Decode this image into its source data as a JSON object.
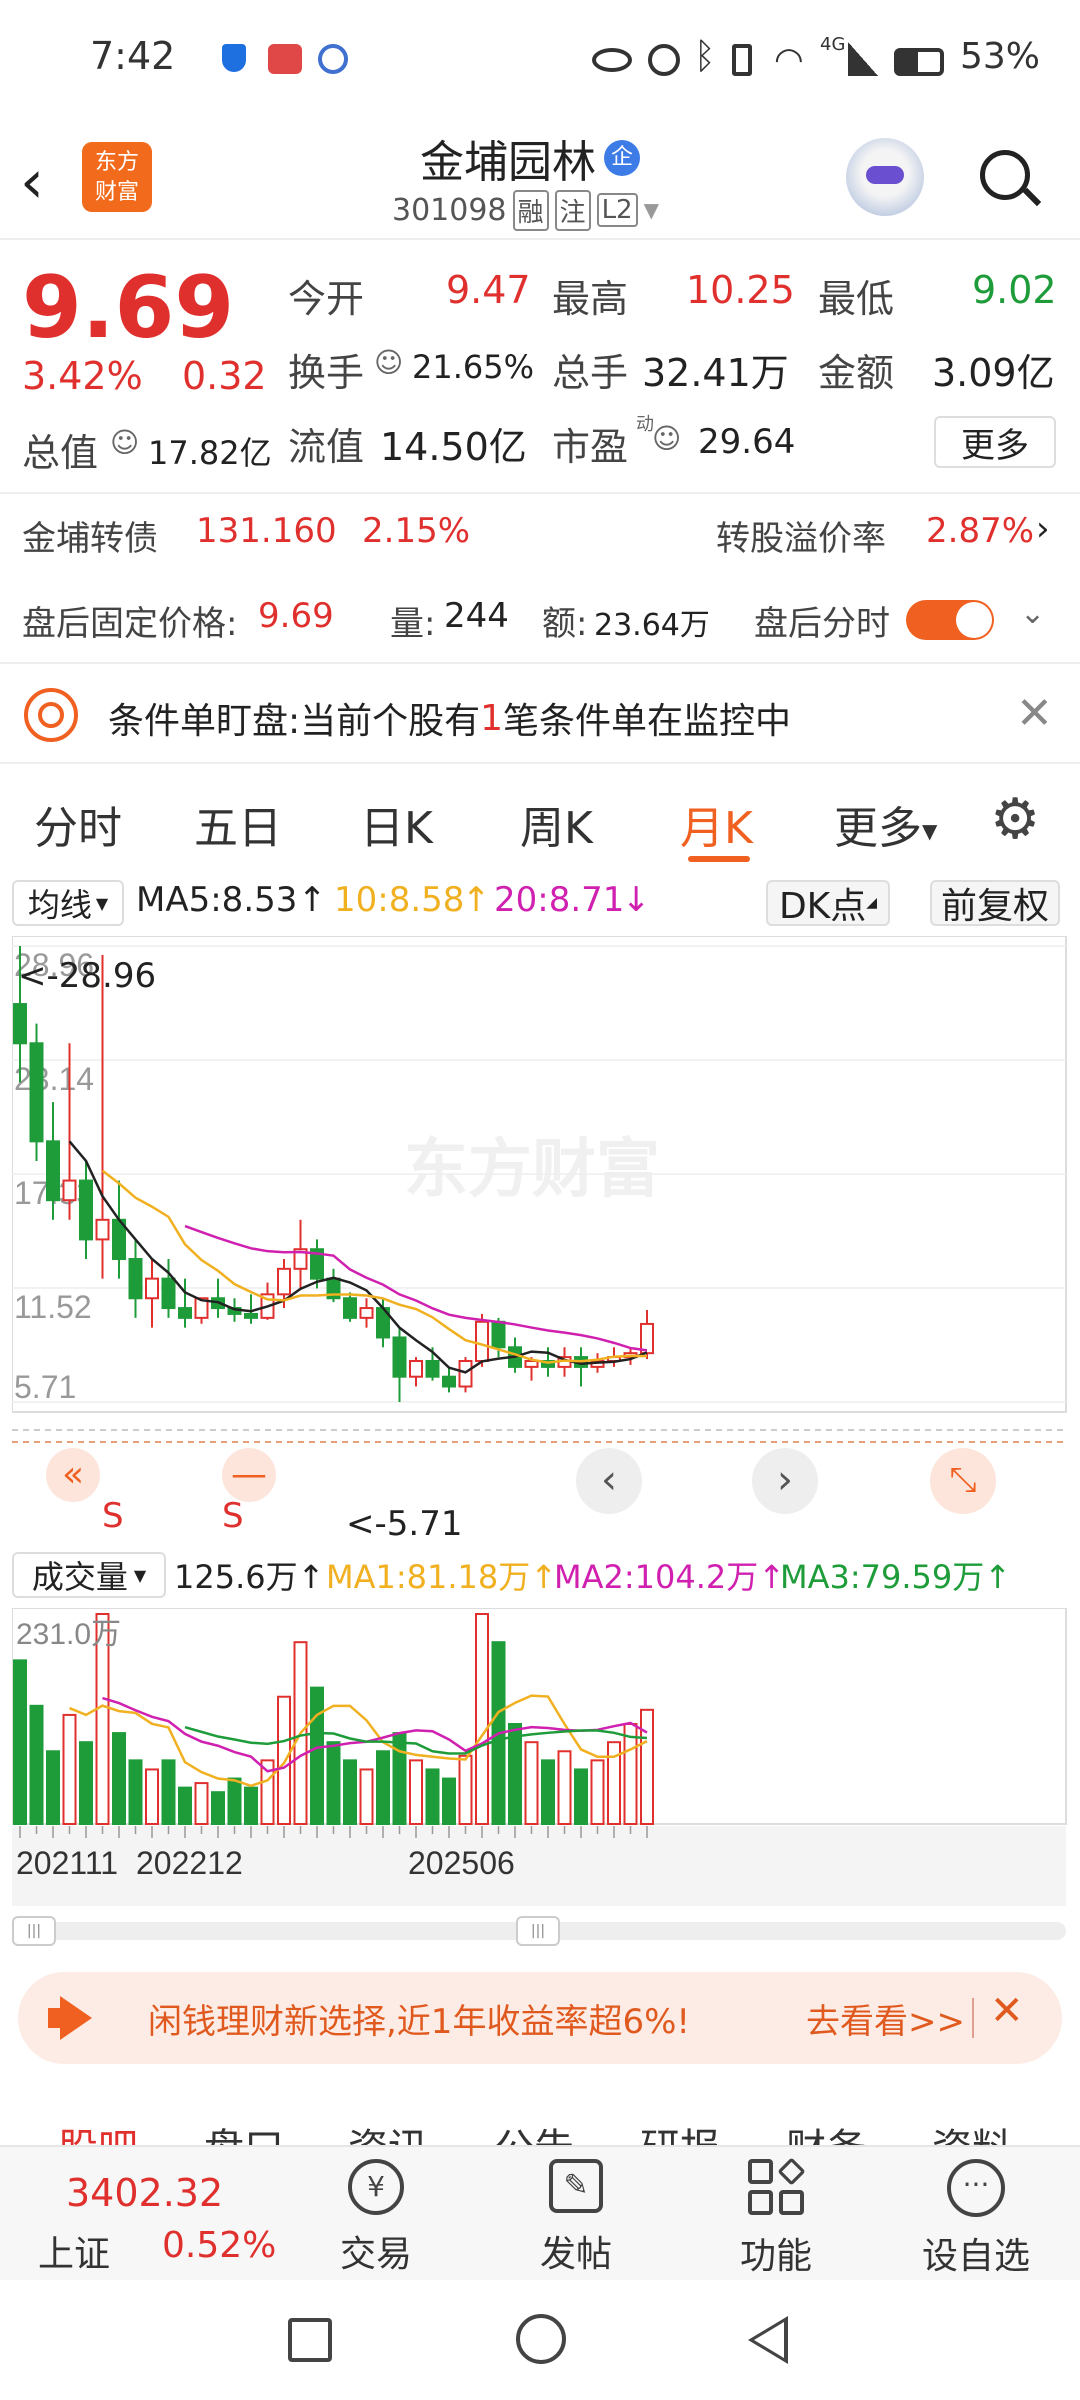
{
  "status": {
    "time": "7:42",
    "battery": "53%",
    "net": "4G"
  },
  "header": {
    "logo_line1": "东方",
    "logo_line2": "财富",
    "title": "金埔园林",
    "title_badge": "企",
    "code": "301098",
    "badge_rong": "融",
    "badge_zhu": "注",
    "badge_l2": "L2"
  },
  "quote": {
    "price": "9.69",
    "pct": "3.42%",
    "chg": "0.32",
    "open_label": "今开",
    "open": "9.47",
    "high_label": "最高",
    "high": "10.25",
    "low_label": "最低",
    "low": "9.02",
    "turnover_label": "换手",
    "turnover": "21.65%",
    "vol_label": "总手",
    "vol": "32.41万",
    "amount_label": "金额",
    "amount": "3.09亿",
    "mcap_label": "总值",
    "mcap": "17.82亿",
    "float_label": "流值",
    "float": "14.50亿",
    "pe_label": "市盈",
    "pe_sup": "动",
    "pe": "29.64",
    "more": "更多"
  },
  "bond": {
    "label": "金埔转债",
    "price": "131.160",
    "pct": "2.15%",
    "prem_label": "转股溢价率",
    "prem": "2.87%"
  },
  "after": {
    "fixed_label": "盘后固定价格:",
    "fixed": "9.69",
    "vol_label": "量:",
    "vol": "244",
    "amt_label": "额:",
    "amt": "23.64万",
    "tl_label": "盘后分时"
  },
  "notice": {
    "pre": "条件单盯盘:当前个股有",
    "num": "1",
    "post": "笔条件单在监控中"
  },
  "tabs": [
    "分时",
    "五日",
    "日K",
    "周K",
    "月K",
    "更多"
  ],
  "chart_head": {
    "ma_sel": "均线",
    "ma5": "MA5:8.53",
    "ma10": "10:8.58",
    "ma20": "20:8.71",
    "dk": "DK点",
    "fq": "前复权",
    "max_label": "<-28.96",
    "min_label": "<-5.71",
    "s1": "S",
    "s2": "S"
  },
  "vol_head": {
    "sel": "成交量",
    "v": "125.6万",
    "ma1": "MA1:81.18万",
    "ma2": "MA2:104.2万",
    "ma3": "MA3:79.59万",
    "top": "231.0万"
  },
  "date_labels": {
    "d1": "202111",
    "d2": "202212",
    "d3": "202506"
  },
  "watermark": "东方财富",
  "banner": {
    "text": "闲钱理财新选择,近1年收益率超6%!",
    "link": "去看看>>"
  },
  "subtabs": [
    "股吧",
    "盘口",
    "资讯",
    "公告",
    "研报",
    "财务",
    "资料"
  ],
  "bottomnav": {
    "index_value": "3402.32",
    "index_name": "上证",
    "index_pct": "0.52%",
    "trade": "交易",
    "post": "发帖",
    "func": "功能",
    "watch": "设自选"
  },
  "colors": {
    "up": "#e0302e",
    "down": "#1e9c3a",
    "ma5": "#222222",
    "ma10": "#f0b020",
    "ma20": "#d020b0",
    "accent": "#f06020"
  },
  "chart_data": {
    "type": "candlestick",
    "ylim": [
      5.71,
      28.96
    ],
    "yticks": [
      "28.96",
      "23.14",
      "17.33",
      "11.52",
      "5.71"
    ],
    "ohlc": [
      [
        26,
        28.96,
        22,
        24
      ],
      [
        24,
        25,
        18,
        19
      ],
      [
        19,
        21,
        15,
        16
      ],
      [
        16,
        24,
        15,
        17
      ],
      [
        17,
        18,
        13,
        14
      ],
      [
        14,
        28.5,
        12,
        15
      ],
      [
        15,
        17,
        12,
        13
      ],
      [
        13,
        14,
        10,
        11
      ],
      [
        11,
        13,
        9.5,
        12
      ],
      [
        12,
        13,
        10,
        10.5
      ],
      [
        10.5,
        12,
        9.5,
        10
      ],
      [
        10,
        11,
        9.7,
        11
      ],
      [
        11,
        12,
        10,
        10.5
      ],
      [
        10.5,
        11,
        9.8,
        10.2
      ],
      [
        10.2,
        11.2,
        9.7,
        10
      ],
      [
        10,
        11.8,
        9.9,
        11.2
      ],
      [
        11.2,
        13,
        10.5,
        12.5
      ],
      [
        12.5,
        15,
        11.5,
        13.5
      ],
      [
        13.5,
        14,
        11.5,
        12
      ],
      [
        12,
        12.5,
        10.8,
        11
      ],
      [
        11,
        11.3,
        9.8,
        10
      ],
      [
        10,
        11,
        9.5,
        10.5
      ],
      [
        10.5,
        11,
        8.5,
        9
      ],
      [
        9,
        9.5,
        5.71,
        7
      ],
      [
        7,
        8,
        6.5,
        7.8
      ],
      [
        7.8,
        8.5,
        6.8,
        7
      ],
      [
        7,
        7.5,
        6.2,
        6.5
      ],
      [
        6.5,
        8,
        6.2,
        7.8
      ],
      [
        7.8,
        10.2,
        7.5,
        9.8
      ],
      [
        9.8,
        10,
        8,
        8.5
      ],
      [
        8.5,
        9,
        7.2,
        7.5
      ],
      [
        7.5,
        8,
        6.8,
        7.8
      ],
      [
        7.8,
        8.5,
        7,
        7.5
      ],
      [
        7.5,
        8.5,
        7,
        8
      ],
      [
        8,
        8.5,
        6.5,
        7.5
      ],
      [
        7.5,
        8.2,
        7.2,
        7.8
      ],
      [
        7.8,
        8.5,
        7.5,
        8
      ],
      [
        8,
        8.5,
        7.6,
        8.2
      ],
      [
        8.2,
        10.4,
        7.9,
        9.69
      ]
    ],
    "volume": [
      180,
      130,
      80,
      120,
      90,
      231,
      100,
      70,
      60,
      70,
      40,
      45,
      35,
      50,
      40,
      70,
      140,
      200,
      150,
      90,
      70,
      60,
      80,
      100,
      70,
      60,
      50,
      75,
      231,
      200,
      110,
      90,
      70,
      80,
      60,
      70,
      90,
      110,
      125.6
    ]
  }
}
